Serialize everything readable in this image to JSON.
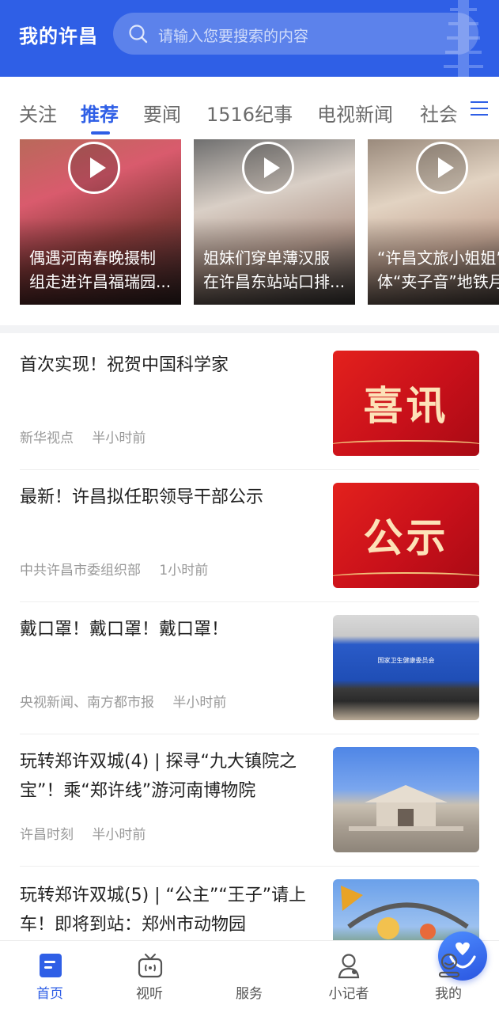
{
  "header": {
    "app_title": "我的许昌",
    "search_placeholder": "请输入您要搜索的内容",
    "bg_color": "#2f5fe6"
  },
  "tabs": [
    {
      "label": "关注",
      "active": false
    },
    {
      "label": "推荐",
      "active": true
    },
    {
      "label": "要闻",
      "active": false
    },
    {
      "label": "1516纪事",
      "active": false
    },
    {
      "label": "电视新闻",
      "active": false
    },
    {
      "label": "社会",
      "active": false
    }
  ],
  "videos": [
    {
      "line1": "偶遇河南春晚摄制",
      "line2": "组走进许昌福瑞园..."
    },
    {
      "line1": "姐妹们穿单薄汉服",
      "line2": "在许昌东站站口排..."
    },
    {
      "line1": "“许昌文旅小姐姐”",
      "line2": "体“夹子音”地铁月"
    }
  ],
  "news": [
    {
      "title": "首次实现！祝贺中国科学家",
      "source": "新华视点",
      "time": "半小时前",
      "thumb_text": "喜讯"
    },
    {
      "title": "最新！许昌拟任职领导干部公示",
      "source": "中共许昌市委组织部",
      "time": "1小时前",
      "thumb_text": "公示"
    },
    {
      "title": "戴口罩！戴口罩！戴口罩！",
      "source": "央视新闻、南方都市报",
      "time": "半小时前",
      "thumb_text": "国家卫生健康委员会"
    },
    {
      "title": "玩转郑许双城(4) | 探寻“九大镇院之宝”！乘“郑许线”游河南博物院",
      "source": "许昌时刻",
      "time": "半小时前",
      "thumb_text": ""
    },
    {
      "title": "玩转郑许双城(5) | “公主”“王子”请上车！即将到站：郑州市动物园",
      "source": "",
      "time": "",
      "thumb_text": ""
    }
  ],
  "bottom_nav": {
    "home": "首页",
    "watch": "视听",
    "service": "服务",
    "reporter": "小记者",
    "mine": "我的"
  }
}
